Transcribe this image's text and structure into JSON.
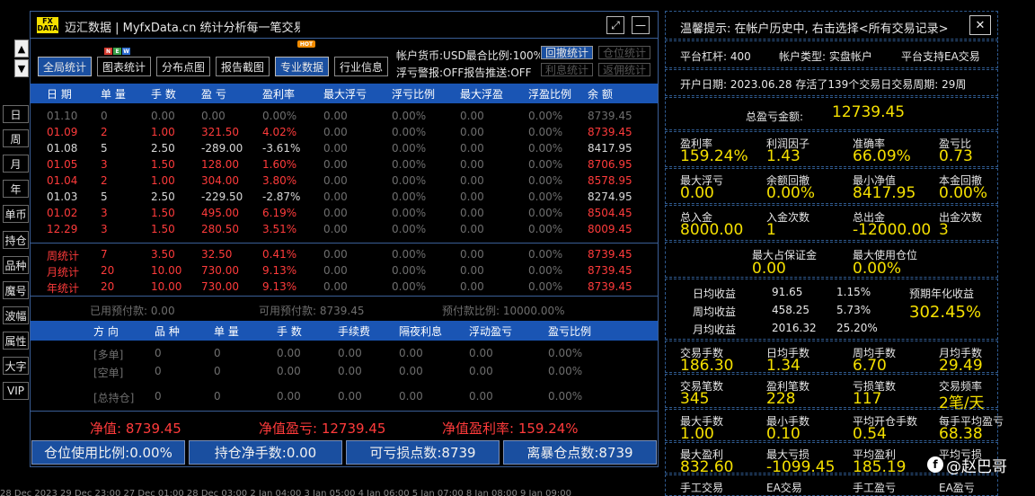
{
  "side": {
    "up_arrow": "▲",
    "down_arrow": "▼",
    "buttons": [
      "日",
      "周",
      "月",
      "年",
      "单币",
      "持仓",
      "品种",
      "魔号",
      "波幅",
      "属性",
      "大字",
      "VIP"
    ]
  },
  "window": {
    "logo_line1": "FX",
    "logo_line2": "DATA",
    "title": "迈汇数据 | MyfxData.cn  统计分析每一笔交易",
    "resize_glyph": "⤢",
    "minimize_glyph": "—"
  },
  "tabs": [
    {
      "label": "全局统计",
      "active": true
    },
    {
      "label": "图表统计",
      "active": false,
      "badge": "NEW"
    },
    {
      "label": "分布点图",
      "active": false
    },
    {
      "label": "报告截图",
      "active": false
    },
    {
      "label": "专业数据",
      "active": true,
      "badge": "HOT"
    },
    {
      "label": "行业信息",
      "active": false
    }
  ],
  "badges": {
    "n": "N",
    "e": "E",
    "w": "W",
    "hot": "HOT"
  },
  "account_info": {
    "line1": "帐户货币:USD最合比例:100%",
    "line2": "浮亏警报:OFF报告推送:OFF"
  },
  "small_buttons": {
    "retracement": "回撤统计",
    "position": "仓位统计",
    "profit": "利息统计",
    "rebate": "返佣统计"
  },
  "table_header": [
    "日 期",
    "单 量",
    "手 数",
    "盈 亏",
    "盈利率",
    "最大浮亏",
    "浮亏比例",
    "最大浮盈",
    "浮盈比例",
    "余 额"
  ],
  "daily_rows": [
    {
      "date": "01.10",
      "count": "0",
      "lots": "0.00",
      "pnl": "0.00",
      "rate": "0.00%",
      "max_float_loss": "0.00",
      "float_loss_pct": "0.00%",
      "max_float_profit": "0.00",
      "float_profit_pct": "0.00%",
      "balance": "8739.45",
      "style": "gray"
    },
    {
      "date": "01.09",
      "count": "2",
      "lots": "1.00",
      "pnl": "321.50",
      "rate": "4.02%",
      "max_float_loss": "0.00",
      "float_loss_pct": "0.00%",
      "max_float_profit": "0.00",
      "float_profit_pct": "0.00%",
      "balance": "8739.45",
      "style": "red"
    },
    {
      "date": "01.08",
      "count": "5",
      "lots": "2.50",
      "pnl": "-289.00",
      "rate": "-3.61%",
      "max_float_loss": "0.00",
      "float_loss_pct": "0.00%",
      "max_float_profit": "0.00",
      "float_profit_pct": "0.00%",
      "balance": "8417.95",
      "style": "white"
    },
    {
      "date": "01.05",
      "count": "3",
      "lots": "1.50",
      "pnl": "128.00",
      "rate": "1.60%",
      "max_float_loss": "0.00",
      "float_loss_pct": "0.00%",
      "max_float_profit": "0.00",
      "float_profit_pct": "0.00%",
      "balance": "8706.95",
      "style": "red"
    },
    {
      "date": "01.04",
      "count": "2",
      "lots": "1.00",
      "pnl": "304.00",
      "rate": "3.80%",
      "max_float_loss": "0.00",
      "float_loss_pct": "0.00%",
      "max_float_profit": "0.00",
      "float_profit_pct": "0.00%",
      "balance": "8578.95",
      "style": "red"
    },
    {
      "date": "01.03",
      "count": "5",
      "lots": "2.50",
      "pnl": "-229.50",
      "rate": "-2.87%",
      "max_float_loss": "0.00",
      "float_loss_pct": "0.00%",
      "max_float_profit": "0.00",
      "float_profit_pct": "0.00%",
      "balance": "8274.95",
      "style": "white"
    },
    {
      "date": "01.02",
      "count": "3",
      "lots": "1.50",
      "pnl": "495.00",
      "rate": "6.19%",
      "max_float_loss": "0.00",
      "float_loss_pct": "0.00%",
      "max_float_profit": "0.00",
      "float_profit_pct": "0.00%",
      "balance": "8504.45",
      "style": "red"
    },
    {
      "date": "12.29",
      "count": "3",
      "lots": "1.50",
      "pnl": "280.50",
      "rate": "3.51%",
      "max_float_loss": "0.00",
      "float_loss_pct": "0.00%",
      "max_float_profit": "0.00",
      "float_profit_pct": "0.00%",
      "balance": "8009.45",
      "style": "red"
    }
  ],
  "summary_rows": [
    {
      "date": "周统计",
      "count": "7",
      "lots": "3.50",
      "pnl": "32.50",
      "rate": "0.41%",
      "max_float_loss": "0.00",
      "float_loss_pct": "0.00%",
      "max_float_profit": "0.00",
      "float_profit_pct": "0.00%",
      "balance": "8739.45",
      "style": "red"
    },
    {
      "date": "月统计",
      "count": "20",
      "lots": "10.00",
      "pnl": "730.00",
      "rate": "9.13%",
      "max_float_loss": "0.00",
      "float_loss_pct": "0.00%",
      "max_float_profit": "0.00",
      "float_profit_pct": "0.00%",
      "balance": "8739.45",
      "style": "red"
    },
    {
      "date": "年统计",
      "count": "20",
      "lots": "10.00",
      "pnl": "730.00",
      "rate": "9.13%",
      "max_float_loss": "0.00",
      "float_loss_pct": "0.00%",
      "max_float_profit": "0.00",
      "float_profit_pct": "0.00%",
      "balance": "8739.45",
      "style": "red"
    }
  ],
  "prepaid": {
    "used": "已用预付款: 0.00",
    "available": "可用预付款: 8739.45",
    "ratio": "预付款比例: 10000.00%"
  },
  "positions_header": [
    "方 向",
    "品 种",
    "单 量",
    "手 数",
    "手续费",
    "隔夜利息",
    "浮动盈亏",
    "盈亏比例"
  ],
  "positions_rows": [
    {
      "dir": "[多单]",
      "symbol": "0",
      "count": "0",
      "lots": "0.00",
      "fee": "0.00",
      "swap": "0.00",
      "float": "0.00",
      "pct": "0.00%"
    },
    {
      "dir": "[空单]",
      "symbol": "0",
      "count": "0",
      "lots": "0.00",
      "fee": "0.00",
      "swap": "0.00",
      "float": "0.00",
      "pct": "0.00%"
    },
    {
      "dir": "[总持仓]",
      "symbol": "0",
      "count": "0",
      "lots": "0.00",
      "fee": "0.00",
      "swap": "0.00",
      "float": "0.00",
      "pct": "0.00%"
    }
  ],
  "net": {
    "equity": "净值: 8739.45",
    "equity_pnl": "净值盈亏: 12739.45",
    "equity_rate": "净值盈利率: 159.24%"
  },
  "bottom_buttons": [
    "仓位使用比例:0.00%",
    "持仓净手数:0.00",
    "可亏损点数:8739",
    "离暴仓点数:8739"
  ],
  "right": {
    "tip": "温馨提示: 在帐户历史中, 右击选择<所有交易记录>",
    "close_glyph": "✕",
    "leverage": "平台杠杆: 400",
    "account_type": "帐户类型: 实盘帐户",
    "ea_support": "平台支持EA交易",
    "open_info": "开户日期: 2023.06.28 存活了139个交易日交易周期: 29周",
    "total_label": "总盈亏金额:",
    "total_value": "12739.45",
    "stats1": [
      {
        "label": "盈利率",
        "value": "159.24%"
      },
      {
        "label": "利润因子",
        "value": "1.43"
      },
      {
        "label": "准确率",
        "value": "66.09%"
      },
      {
        "label": "盈亏比",
        "value": "0.73"
      }
    ],
    "stats2": [
      {
        "label": "最大浮亏",
        "value": "0.00"
      },
      {
        "label": "余额回撤",
        "value": "0.00%"
      },
      {
        "label": "最小净值",
        "value": "8417.95"
      },
      {
        "label": "本金回撤",
        "value": "0.00%"
      }
    ],
    "stats3": [
      {
        "label": "总入金",
        "value": "8000.00"
      },
      {
        "label": "入金次数",
        "value": "1"
      },
      {
        "label": "总出金",
        "value": "-12000.00"
      },
      {
        "label": "出金次数",
        "value": "3"
      }
    ],
    "margin": [
      {
        "label": "最大占保证金",
        "value": "0.00"
      },
      {
        "label": "最大使用仓位",
        "value": "0.00%"
      }
    ],
    "avg_rows": [
      {
        "label": "日均收益",
        "amount": "91.65",
        "pct": "1.15%"
      },
      {
        "label": "周均收益",
        "amount": "458.25",
        "pct": "5.73%"
      },
      {
        "label": "月均收益",
        "amount": "2016.32",
        "pct": "25.20%"
      }
    ],
    "annual_label": "预期年化收益",
    "annual_value": "302.45%",
    "stats4": [
      {
        "label": "交易手数",
        "value": "186.30"
      },
      {
        "label": "日均手数",
        "value": "1.34"
      },
      {
        "label": "周均手数",
        "value": "6.70"
      },
      {
        "label": "月均手数",
        "value": "29.49"
      }
    ],
    "stats5": [
      {
        "label": "交易笔数",
        "value": "345"
      },
      {
        "label": "盈利笔数",
        "value": "228"
      },
      {
        "label": "亏损笔数",
        "value": "117"
      },
      {
        "label": "交易频率",
        "value": "2笔/天"
      }
    ],
    "stats6": [
      {
        "label": "最大手数",
        "value": "1.00"
      },
      {
        "label": "最小手数",
        "value": "0.10"
      },
      {
        "label": "平均开仓手数",
        "value": "0.54"
      },
      {
        "label": "每手平均盈亏",
        "value": "68.38"
      }
    ],
    "stats7": [
      {
        "label": "最大盈利",
        "value": "832.60"
      },
      {
        "label": "最大亏损",
        "value": "-1099.45"
      },
      {
        "label": "平均盈利",
        "value": "185.19"
      },
      {
        "label": "平均亏损",
        "value": ""
      }
    ],
    "stats8": [
      "手工交易",
      "EA交易",
      "手工盈亏",
      "EA盈亏"
    ]
  },
  "watermark": {
    "icon": "f",
    "text": "@赵巴哥"
  },
  "ticker": "28 Dec 2023    29 Dec 23:00    27 Dec 01:00    28 Dec 03:00    2 Jan 04:00    3 Jan 05:00    4 Jan 06:00    5 Jan 07:00    8 Jan 08:00    9 Jan 09:00"
}
